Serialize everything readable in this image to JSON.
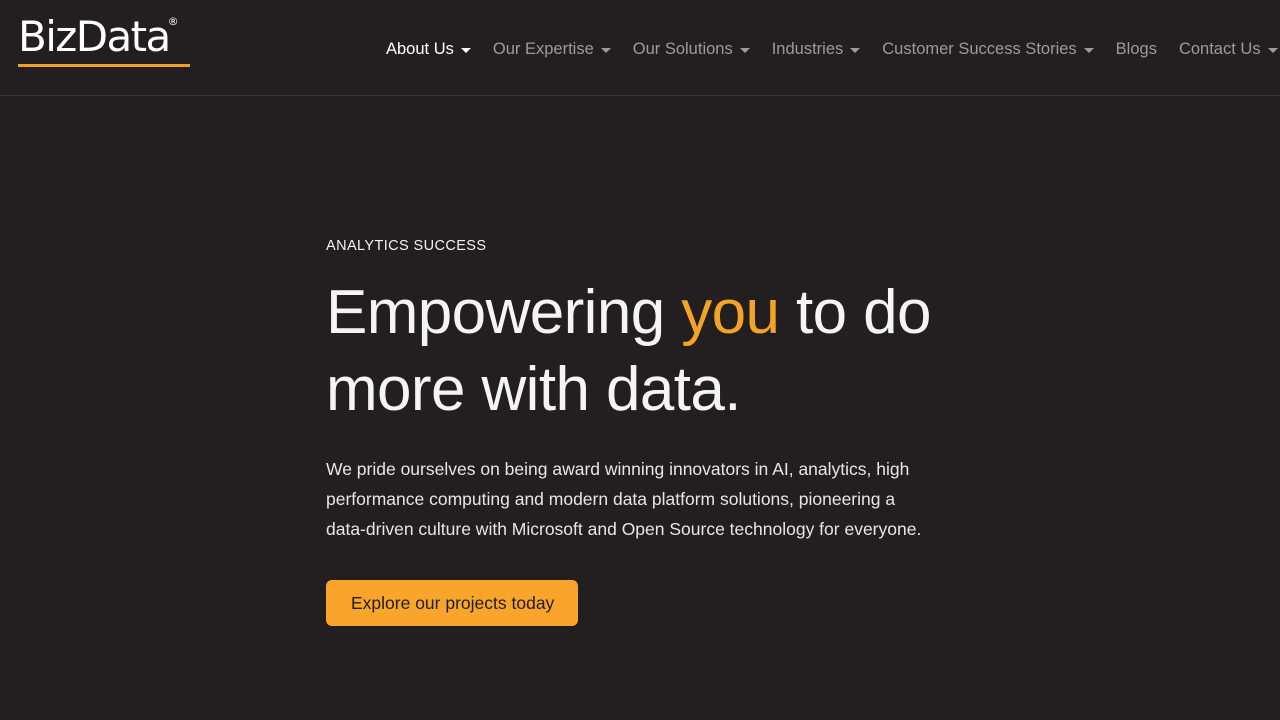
{
  "theme": {
    "background": "#231f20",
    "accent": "#f3a325",
    "button_bg": "#f9a52b",
    "button_text": "#201d1d",
    "nav_inactive": "#9c9a9a",
    "nav_active": "#ffffff",
    "header_border": "#3b3738",
    "logo_rule": "#eda22a"
  },
  "header": {
    "brand": {
      "name": "BizData",
      "trademark": "®"
    },
    "nav": [
      {
        "label": "About Us",
        "has_caret": true,
        "active": true,
        "icon": "chevron-down-icon"
      },
      {
        "label": "Our Expertise",
        "has_caret": true,
        "active": false,
        "icon": "chevron-down-icon"
      },
      {
        "label": "Our Solutions",
        "has_caret": true,
        "active": false,
        "icon": "chevron-down-icon"
      },
      {
        "label": "Industries",
        "has_caret": true,
        "active": false,
        "icon": "chevron-down-icon"
      },
      {
        "label": "Customer Success Stories",
        "has_caret": true,
        "active": false,
        "icon": "chevron-down-icon"
      },
      {
        "label": "Blogs",
        "has_caret": false,
        "active": false,
        "icon": ""
      },
      {
        "label": "Contact Us",
        "has_caret": true,
        "active": false,
        "icon": "chevron-down-icon"
      }
    ]
  },
  "hero": {
    "eyebrow": "ANALYTICS SUCCESS",
    "title_part1": "Empowering ",
    "title_accent": "you",
    "title_part2": " to do more with data.",
    "body": "We pride ourselves on being award winning innovators in AI, analytics, high performance computing and modern data platform solutions, pioneering a data-driven culture with Microsoft and Open Source technology for everyone.",
    "cta_label": "Explore our projects today"
  }
}
